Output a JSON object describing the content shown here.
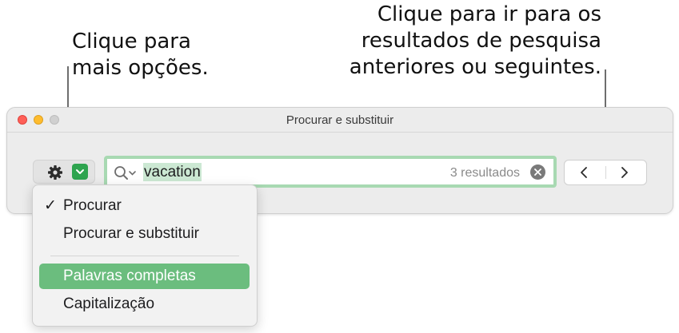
{
  "callouts": {
    "options_line1": "Clique para",
    "options_line2": "mais opções.",
    "nav_line1": "Clique para ir para os",
    "nav_line2": "resultados de pesquisa",
    "nav_line3": "anteriores ou seguintes."
  },
  "window": {
    "title": "Procurar e substituir"
  },
  "toolbar": {
    "options_icon": "gear-icon",
    "options_dropdown_icon": "chevron-down-icon"
  },
  "search": {
    "value": "vacation",
    "result_count": "3 resultados",
    "icon": "magnifier-with-chevron-icon",
    "clear_icon": "clear-circle-icon"
  },
  "navigation": {
    "prev_icon": "chevron-left-icon",
    "next_icon": "chevron-right-icon"
  },
  "menu": {
    "items": [
      {
        "label": "Procurar",
        "checked": true
      },
      {
        "label": "Procurar e substituir",
        "checked": false
      },
      {
        "label": "Palavras completas",
        "checked": false,
        "highlighted": true
      },
      {
        "label": "Capitalização",
        "checked": false
      }
    ],
    "check_mark": "✓"
  },
  "colors": {
    "accent_green": "#2ea44f",
    "highlight_green": "#6bbd7e",
    "focus_ring": "#a8d9b2"
  }
}
